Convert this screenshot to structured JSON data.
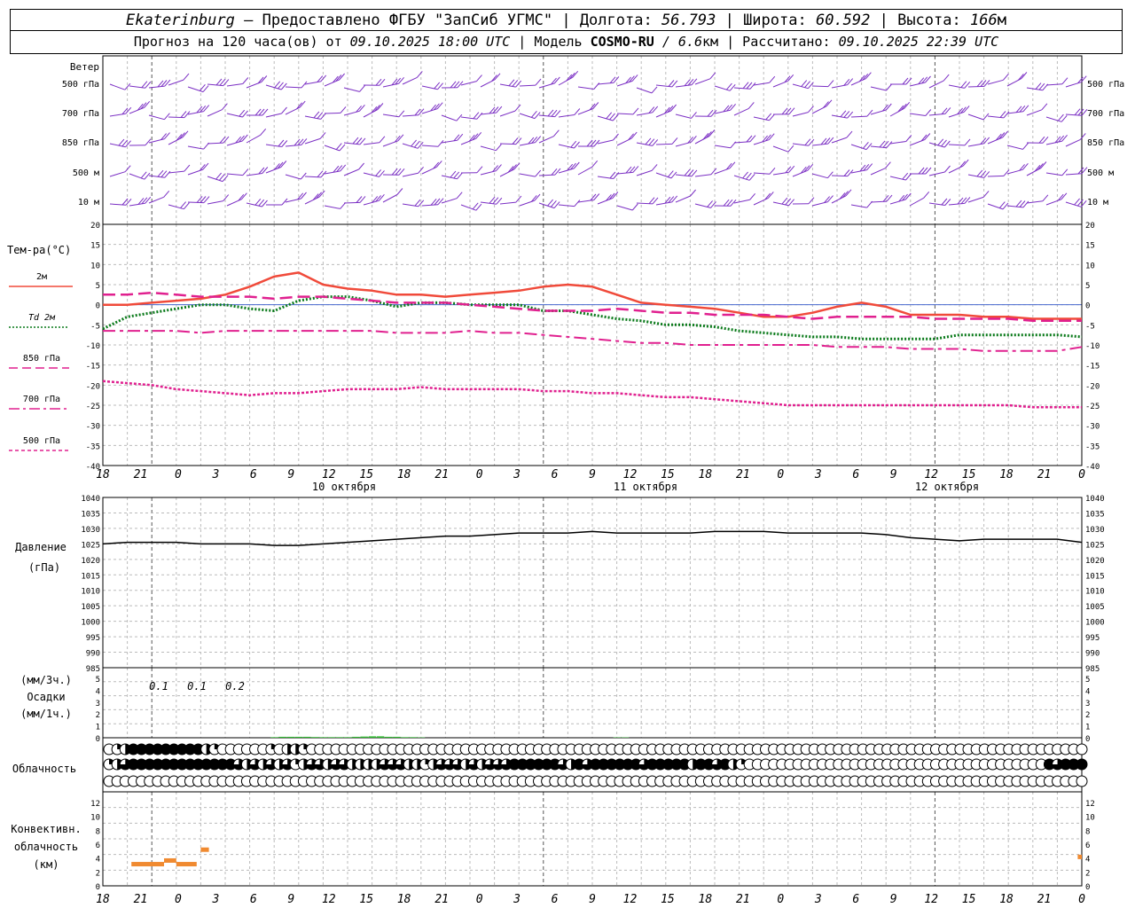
{
  "header": {
    "city": "Ekaterinburg",
    "provider": " – Предоставлено ФГБУ \"ЗапСиб УГМС\" | ",
    "lon_label": "Долгота: ",
    "lon": "56.793",
    "lat_label": " | Широта: ",
    "lat": "60.592",
    "alt_label": " | Высота: ",
    "alt": "166",
    "alt_unit": "м",
    "fc_prefix": "Прогноз на 120 часа(ов) от ",
    "fc_time": "09.10.2025 18:00 UTC",
    "model_label": " | Модель ",
    "model": "COSMO-RU",
    "model_res": " / 6.6",
    "model_res_unit": "км",
    "calc_label": " | Рассчитано: ",
    "calc_time": "09.10.2025 22:39 UTC"
  },
  "wind_panel": {
    "title": "Ветер",
    "levels": [
      "500 гПа",
      "700 гПа",
      "850 гПа",
      "500 м",
      "10  м"
    ],
    "color": "#7b2fc4"
  },
  "temp_panel": {
    "title": "Тем-ра(°C)",
    "legend": [
      {
        "label": "2м",
        "color": "#f04a3a",
        "style": "solid"
      },
      {
        "label": "Td  2м",
        "color": "#0a7a1a",
        "style": "dotted"
      },
      {
        "label": "850 гПа",
        "color": "#e0208f",
        "style": "dashed"
      },
      {
        "label": "700 гПа",
        "color": "#e0208f",
        "style": "dashdot"
      },
      {
        "label": "500 гПа",
        "color": "#e0208f",
        "style": "dotted"
      }
    ],
    "y_ticks": [
      "20",
      "15",
      "10",
      "5",
      "0",
      "-5",
      "-10",
      "-15",
      "-20",
      "-25",
      "-30",
      "-35",
      "-40"
    ]
  },
  "time_axis": {
    "labels": [
      "18",
      "21",
      "0",
      "3",
      "6",
      "9",
      "12",
      "15",
      "18",
      "21",
      "0",
      "3",
      "6",
      "9",
      "12",
      "15",
      "18",
      "21",
      "0",
      "3",
      "6",
      "9",
      "12",
      "15",
      "18",
      "21",
      "0"
    ],
    "dates": [
      "10 октября",
      "11 октября",
      "12 октября"
    ]
  },
  "pressure_panel": {
    "title_line1": "Давление",
    "title_line2": "(гПа)",
    "y_ticks": [
      "1040",
      "1035",
      "1030",
      "1025",
      "1020",
      "1015",
      "1010",
      "1005",
      "1000",
      "995",
      "990",
      "985"
    ]
  },
  "precip_panel": {
    "unit_top": "(мм/3ч.)",
    "title": "Осадки",
    "unit_bottom": "(мм/1ч.)",
    "y_ticks": [
      "5",
      "4",
      "3",
      "2",
      "1",
      "0"
    ],
    "labels": [
      "0.1",
      "0.1",
      "0.2"
    ]
  },
  "cloud_panel": {
    "title": "Облачность"
  },
  "conv_panel": {
    "title_line1": "Конвективн.",
    "title_line2": "облачность",
    "title_line3": "(км)",
    "y_ticks": [
      "12",
      "10",
      "8",
      "6",
      "4",
      "2",
      "0"
    ]
  },
  "chart_data": {
    "type": "line",
    "x_hours": [
      0,
      3,
      6,
      9,
      12,
      15,
      18,
      21,
      24,
      27,
      30,
      33,
      36,
      39,
      42,
      45,
      48,
      51,
      54,
      57,
      60,
      63,
      66,
      69,
      72,
      75,
      78,
      81,
      84,
      87,
      90,
      93,
      96,
      99,
      102,
      105,
      108,
      111,
      114,
      117,
      120
    ],
    "temperature": {
      "ylim": [
        -40,
        20
      ],
      "series": [
        {
          "name": "2м",
          "values": [
            0,
            0,
            0.5,
            1,
            1.5,
            2.5,
            4.5,
            7,
            8,
            5,
            4,
            3.5,
            2.5,
            2.5,
            2,
            2.5,
            3,
            3.5,
            4.5,
            5,
            4.5,
            2.5,
            0.5,
            0,
            -0.5,
            -1,
            -2,
            -3,
            -3,
            -2,
            -0.5,
            0.5,
            -0.5,
            -2.5,
            -2.5,
            -2.5,
            -3,
            -3,
            -3.5,
            -3.5,
            -3.5
          ]
        },
        {
          "name": "Td  2м",
          "values": [
            -6,
            -3,
            -2,
            -1,
            0,
            0,
            -1,
            -1.5,
            1,
            2,
            2,
            1,
            -0.5,
            0.5,
            0.5,
            0,
            0,
            0,
            -1.5,
            -1.5,
            -2.5,
            -3.5,
            -4,
            -5,
            -5,
            -5.5,
            -6.5,
            -7,
            -7.5,
            -8,
            -8,
            -8.5,
            -8.5,
            -8.5,
            -8.5,
            -7.5,
            -7.5,
            -7.5,
            -7.5,
            -7.5,
            -8
          ]
        },
        {
          "name": "850 гПа",
          "values": [
            2.5,
            2.5,
            3,
            2.5,
            2,
            2,
            2,
            1.5,
            2,
            2,
            1.5,
            1,
            0.5,
            0.5,
            0.5,
            0,
            -0.5,
            -1,
            -1.5,
            -1.5,
            -1.5,
            -1,
            -1.5,
            -2,
            -2,
            -2.5,
            -2.5,
            -2.5,
            -3,
            -3.5,
            -3,
            -3,
            -3,
            -3,
            -3.5,
            -3.5,
            -3.5,
            -3.5,
            -4,
            -4,
            -4
          ]
        },
        {
          "name": "700 гПа",
          "values": [
            -6.5,
            -6.5,
            -6.5,
            -6.5,
            -7,
            -6.5,
            -6.5,
            -6.5,
            -6.5,
            -6.5,
            -6.5,
            -6.5,
            -7,
            -7,
            -7,
            -6.5,
            -7,
            -7,
            -7.5,
            -8,
            -8.5,
            -9,
            -9.5,
            -9.5,
            -10,
            -10,
            -10,
            -10,
            -10,
            -10,
            -10.5,
            -10.5,
            -10.5,
            -11,
            -11,
            -11,
            -11.5,
            -11.5,
            -11.5,
            -11.5,
            -10.5
          ]
        },
        {
          "name": "500 гПа",
          "values": [
            -19,
            -19.5,
            -20,
            -21,
            -21.5,
            -22,
            -22.5,
            -22,
            -22,
            -21.5,
            -21,
            -21,
            -21,
            -20.5,
            -21,
            -21,
            -21,
            -21,
            -21.5,
            -21.5,
            -22,
            -22,
            -22.5,
            -23,
            -23,
            -23.5,
            -24,
            -24.5,
            -25,
            -25,
            -25,
            -25,
            -25,
            -25,
            -25,
            -25,
            -25,
            -25,
            -25.5,
            -25.5,
            -25.5
          ]
        }
      ]
    },
    "pressure": {
      "ylim": [
        985,
        1040
      ],
      "values": [
        1025,
        1025.5,
        1025.5,
        1025.5,
        1025,
        1025,
        1025,
        1024.5,
        1024.5,
        1025,
        1025.5,
        1026,
        1026.5,
        1027,
        1027.5,
        1027.5,
        1028,
        1028.5,
        1028.5,
        1028.5,
        1029,
        1028.5,
        1028.5,
        1028.5,
        1028.5,
        1029,
        1029,
        1029,
        1028.5,
        1028.5,
        1028.5,
        1028.5,
        1028,
        1027,
        1026.5,
        1026,
        1026.5,
        1026.5,
        1026.5,
        1026.5,
        1025.5
      ]
    },
    "precipitation_mm_per_h": {
      "ylim": [
        0,
        5
      ],
      "x_hours": [
        21,
        22,
        23,
        24,
        25,
        26,
        27,
        28,
        29,
        30,
        31,
        32,
        33,
        34,
        35,
        36,
        37,
        38,
        39,
        63,
        64
      ],
      "values": [
        0.05,
        0.08,
        0.08,
        0.08,
        0.08,
        0.06,
        0.05,
        0.05,
        0.05,
        0.05,
        0.08,
        0.1,
        0.12,
        0.12,
        0.08,
        0.08,
        0.05,
        0.05,
        0.03,
        0.03,
        0.03
      ]
    },
    "precipitation_3h_labels": [
      {
        "hour": 22.5,
        "value": "0.1"
      },
      {
        "hour": 25.5,
        "value": "0.1"
      },
      {
        "hour": 28.5,
        "value": "0.2"
      }
    ],
    "cloud_cover_octas": {
      "rows": [
        "upper",
        "middle",
        "lower"
      ],
      "upper": [
        0,
        2,
        4,
        8,
        8,
        8,
        8,
        8,
        8,
        8,
        8,
        8,
        4,
        2,
        0,
        0,
        0,
        0,
        0,
        0,
        2,
        0,
        4,
        4,
        2,
        0,
        0,
        0,
        0,
        0,
        0,
        0,
        0,
        0,
        0,
        0,
        0,
        0,
        0,
        0,
        0,
        0,
        0,
        0,
        0,
        0,
        0,
        0,
        0,
        0,
        0,
        0,
        0,
        0,
        0,
        0,
        0,
        0,
        0,
        0,
        0,
        0,
        0,
        0,
        0,
        0,
        0,
        0,
        0,
        0,
        0,
        0,
        0,
        0,
        0,
        0,
        0,
        0,
        0,
        0,
        0,
        0,
        0,
        0,
        0,
        0,
        0,
        0,
        0,
        0,
        0,
        0,
        0,
        0,
        0,
        0,
        0,
        0,
        0,
        0,
        0,
        0,
        0,
        0,
        0,
        0,
        0,
        0,
        0,
        0,
        0,
        0,
        0,
        0,
        0,
        0,
        0,
        0,
        0,
        0,
        0
      ],
      "middle": [
        2,
        4,
        6,
        8,
        8,
        8,
        8,
        8,
        8,
        8,
        8,
        8,
        8,
        8,
        8,
        8,
        6,
        4,
        6,
        4,
        6,
        4,
        6,
        2,
        4,
        6,
        6,
        4,
        6,
        6,
        4,
        4,
        4,
        4,
        6,
        6,
        6,
        4,
        4,
        2,
        4,
        6,
        6,
        6,
        4,
        6,
        4,
        6,
        6,
        6,
        8,
        8,
        8,
        8,
        8,
        8,
        6,
        4,
        8,
        6,
        8,
        8,
        8,
        8,
        8,
        8,
        6,
        8,
        8,
        8,
        8,
        8,
        4,
        8,
        8,
        6,
        8,
        4,
        2,
        0,
        0,
        0,
        0,
        0,
        0,
        0,
        0,
        0,
        0,
        0,
        0,
        0,
        0,
        0,
        0,
        0,
        0,
        0,
        0,
        0,
        0,
        0,
        0,
        0,
        0,
        0,
        0,
        0,
        0,
        0,
        0,
        0,
        0,
        0,
        0,
        0,
        8,
        6,
        8,
        8,
        8
      ],
      "lower": [
        0,
        0,
        0,
        0,
        0,
        0,
        0,
        0,
        0,
        0,
        0,
        0,
        0,
        0,
        0,
        0,
        0,
        0,
        0,
        0,
        0,
        0,
        0,
        0,
        0,
        0,
        0,
        0,
        0,
        0,
        0,
        0,
        0,
        0,
        0,
        0,
        0,
        0,
        0,
        0,
        0,
        0,
        0,
        0,
        0,
        0,
        0,
        0,
        0,
        0,
        0,
        0,
        0,
        0,
        0,
        0,
        0,
        0,
        0,
        0,
        0,
        0,
        0,
        0,
        0,
        0,
        0,
        0,
        0,
        0,
        0,
        0,
        0,
        0,
        0,
        0,
        0,
        0,
        0,
        0,
        0,
        0,
        0,
        0,
        0,
        0,
        0,
        0,
        0,
        0,
        0,
        0,
        0,
        0,
        0,
        0,
        0,
        0,
        0,
        0,
        0,
        0,
        0,
        0,
        0,
        0,
        0,
        0,
        0,
        0,
        0,
        0,
        0,
        0,
        0,
        0,
        0,
        0,
        0,
        0,
        0
      ]
    },
    "convective_cloud_km": {
      "ylim": [
        0,
        13
      ],
      "segments": [
        {
          "x0": 3.5,
          "x1": 7.5,
          "y": 3
        },
        {
          "x0": 7.5,
          "x1": 9,
          "y": 3.5
        },
        {
          "x0": 9,
          "x1": 11.5,
          "y": 3
        },
        {
          "x0": 12,
          "x1": 13,
          "y": 5
        },
        {
          "x0": 119.5,
          "x1": 120,
          "y": 4
        }
      ]
    }
  }
}
